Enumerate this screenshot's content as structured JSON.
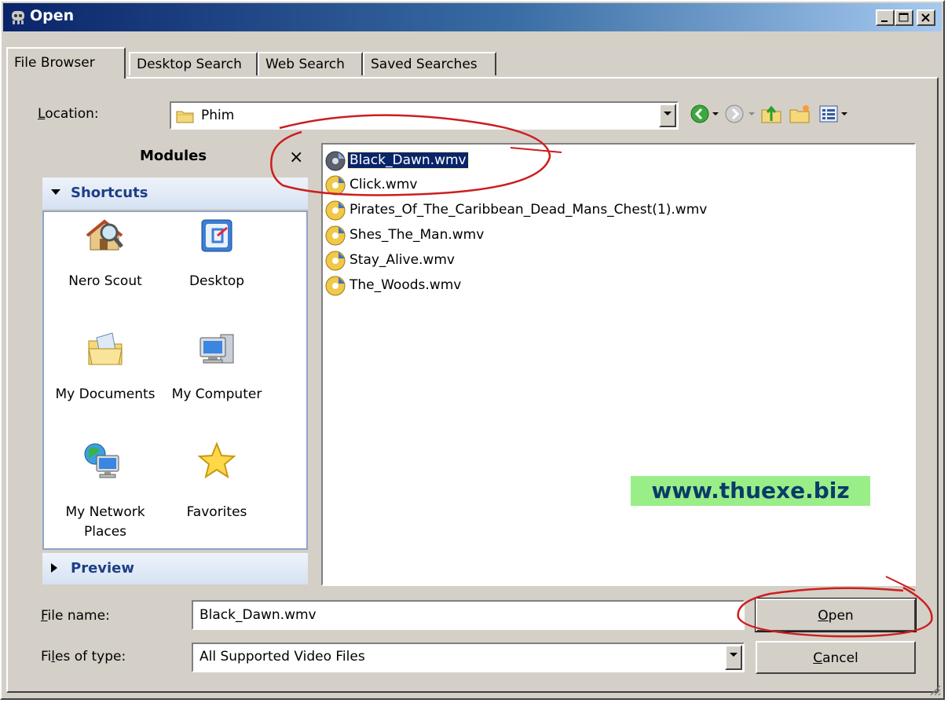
{
  "window": {
    "title": "Open"
  },
  "tabs": [
    {
      "label": "File Browser"
    },
    {
      "label": "Desktop Search"
    },
    {
      "label": "Web Search"
    },
    {
      "label": "Saved Searches"
    }
  ],
  "location": {
    "label_first": "L",
    "label_rest": "ocation:",
    "value": "Phim"
  },
  "modules": {
    "title": "Modules",
    "close_glyph": "×",
    "shortcuts_label": "Shortcuts",
    "preview_label": "Preview",
    "items": [
      {
        "label": "Nero Scout",
        "icon": "nero-scout-icon"
      },
      {
        "label": "Desktop",
        "icon": "desktop-icon"
      },
      {
        "label": "My Documents",
        "icon": "my-documents-icon"
      },
      {
        "label": "My Computer",
        "icon": "my-computer-icon"
      },
      {
        "label": "My Network",
        "label2": "Places",
        "icon": "my-network-places-icon"
      },
      {
        "label": "Favorites",
        "icon": "favorites-icon"
      }
    ]
  },
  "files": [
    {
      "name": "Black_Dawn.wmv",
      "selected": true
    },
    {
      "name": "Click.wmv"
    },
    {
      "name": "Pirates_Of_The_Caribbean_Dead_Mans_Chest(1).wmv"
    },
    {
      "name": "Shes_The_Man.wmv"
    },
    {
      "name": "Stay_Alive.wmv"
    },
    {
      "name": "The_Woods.wmv"
    }
  ],
  "watermark": "www.thuexe.biz",
  "filename": {
    "label_first": "F",
    "label_rest": "ile name:",
    "value": "Black_Dawn.wmv"
  },
  "filetype": {
    "label_pre": "Fi",
    "label_u": "l",
    "label_rest": "es of type:",
    "value": "All Supported Video Files"
  },
  "buttons": {
    "open_first": "O",
    "open_rest": "pen",
    "cancel_first": "C",
    "cancel_rest": "ancel"
  },
  "colors": {
    "title_start": "#0a246a",
    "title_end": "#a6caf0",
    "annotation": "#cc1e1e",
    "watermark_bg": "#99ee88"
  }
}
